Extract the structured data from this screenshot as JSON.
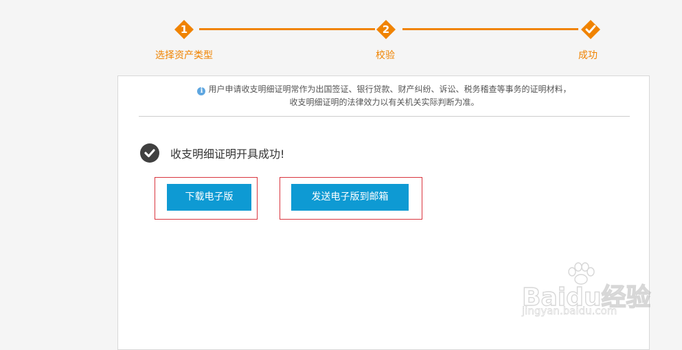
{
  "steps": [
    {
      "number": "1",
      "label": "选择资产类型"
    },
    {
      "number": "2",
      "label": "校验"
    },
    {
      "number": "",
      "label": "成功"
    }
  ],
  "notice": {
    "line1": "用户申请收支明细证明常作为出国签证、银行贷款、财产纠纷、诉讼、税务稽查等事务的证明材料，",
    "line2": "收支明细证明的法律效力以有关机关实际判断为准。"
  },
  "success_message": "收支明细证明开具成功!",
  "buttons": {
    "download": "下载电子版",
    "email": "发送电子版到邮箱"
  },
  "watermark": {
    "logo_text": "Baidu经验",
    "url": "jingyan.baidu.com"
  },
  "colors": {
    "accent": "#f08300",
    "button": "#0e9ad3",
    "highlight": "#d9343d"
  }
}
